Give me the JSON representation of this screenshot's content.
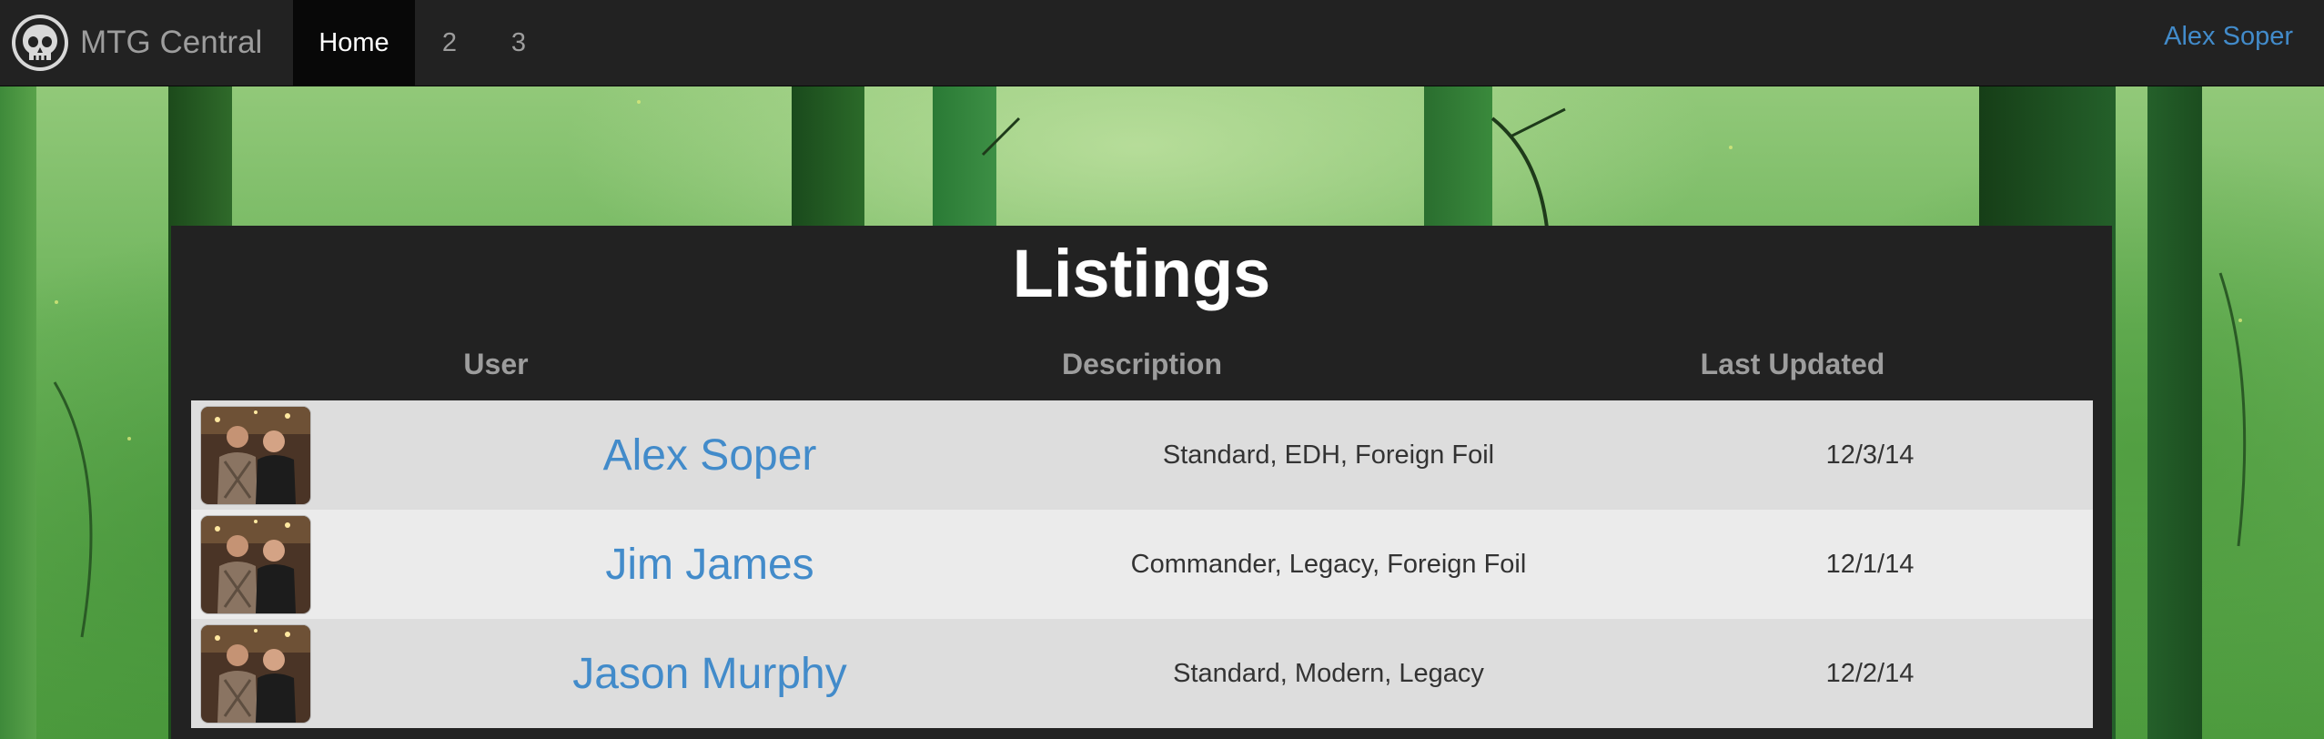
{
  "navbar": {
    "brand": "MTG Central",
    "items": [
      {
        "label": "Home",
        "active": true
      },
      {
        "label": "2",
        "active": false
      },
      {
        "label": "3",
        "active": false
      }
    ],
    "user": "Alex Soper"
  },
  "listings": {
    "title": "Listings",
    "columns": [
      "User",
      "Description",
      "Last Updated"
    ],
    "rows": [
      {
        "user": "Alex Soper",
        "description": "Standard, EDH, Foreign Foil",
        "updated": "12/3/14"
      },
      {
        "user": "Jim James",
        "description": "Commander, Legacy, Foreign Foil",
        "updated": "12/1/14"
      },
      {
        "user": "Jason Murphy",
        "description": "Standard, Modern, Legacy",
        "updated": "12/2/14"
      }
    ]
  },
  "colors": {
    "navbar": "#222222",
    "link": "#428bca",
    "panel": "#222222",
    "row_odd": "#dddddd",
    "row_even": "#ebebeb"
  },
  "icons": {
    "brand": "skull-icon",
    "avatar": "user-photo"
  }
}
